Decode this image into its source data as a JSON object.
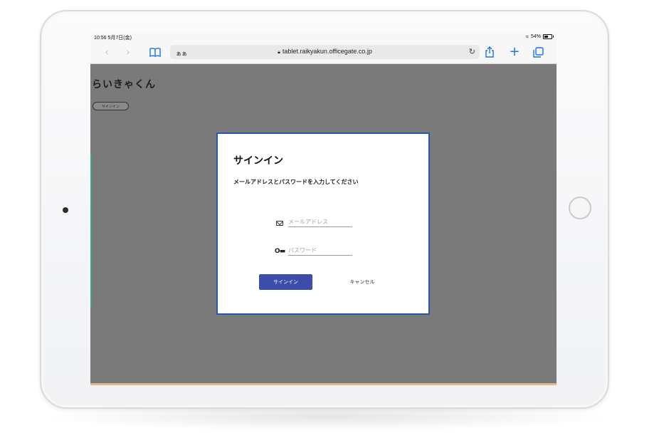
{
  "status_bar": {
    "time": "10:56 5月7日(金)",
    "battery": "54%"
  },
  "browser": {
    "reader_label": "ぁぁ",
    "url": "tablet.raikyakun.officegate.co.jp",
    "icons": [
      "back-icon",
      "forward-icon",
      "bookmarks-icon",
      "lock-icon",
      "reload-icon",
      "share-icon",
      "new-tab-icon",
      "tabs-icon"
    ]
  },
  "page": {
    "title": "らいきゃくん",
    "signin_button": "サインイン"
  },
  "dialog": {
    "title": "サインイン",
    "message": "メールアドレスとパスワードを入力してください",
    "email_placeholder": "メールアドレス",
    "password_placeholder": "パスワード",
    "submit_label": "サインイン",
    "cancel_label": "キャンセル"
  },
  "colors": {
    "dialog_border": "#2757a7",
    "primary_button": "#3c4dab",
    "browser_accent": "#1a73e8",
    "overlay": "#7a7a7a"
  }
}
